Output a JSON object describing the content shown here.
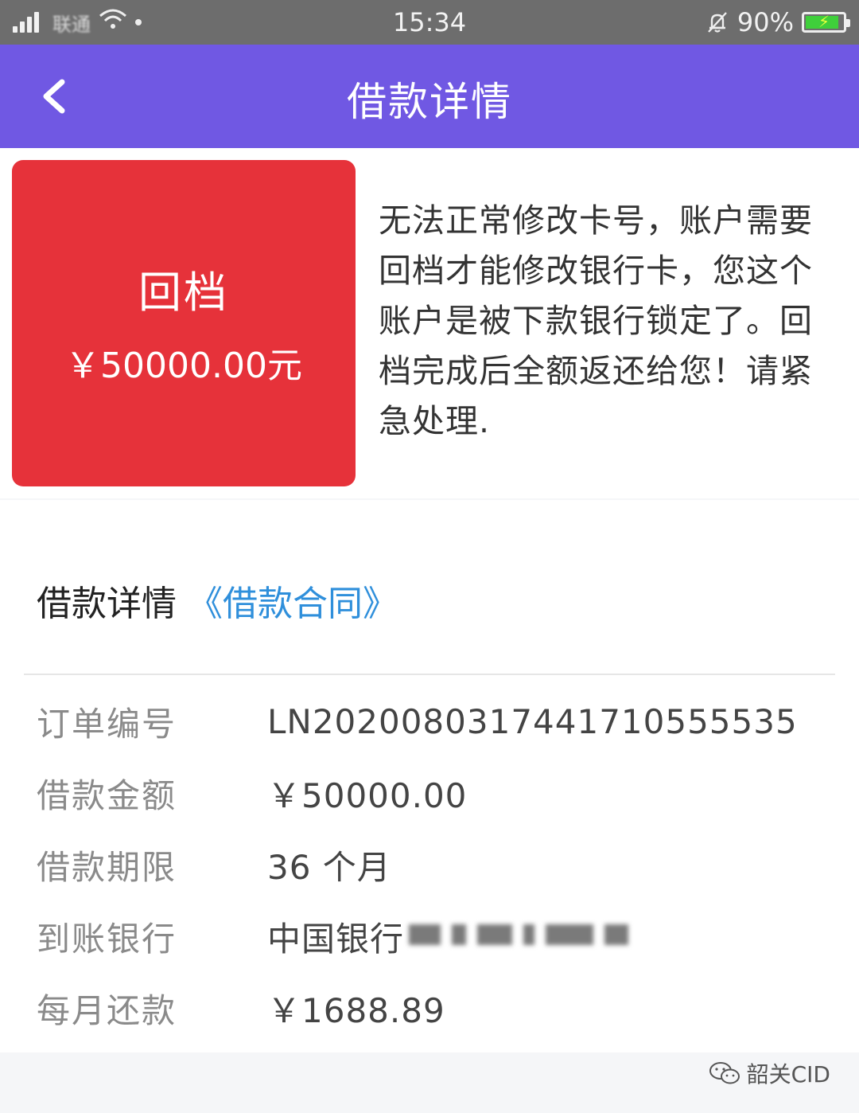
{
  "status_bar": {
    "carrier": "联通",
    "time": "15:34",
    "battery": "90%",
    "battery_level": 0.9
  },
  "nav": {
    "title": "借款详情"
  },
  "rollback_card": {
    "title": "回档",
    "amount": "￥50000.00元"
  },
  "notice": {
    "text": "无法正常修改卡号，账户需要回档才能修改银行卡，您这个账户是被下款银行锁定了。回档完成后全额返还给您！请紧急处理."
  },
  "details": {
    "header": "借款详情",
    "contract_link": "《借款合同》",
    "rows": [
      {
        "label": "订单编号",
        "value": "LN2020080317441710555535"
      },
      {
        "label": "借款金额",
        "value": "￥50000.00"
      },
      {
        "label": "借款期限",
        "value": "36 个月"
      },
      {
        "label": "到账银行",
        "value": "中国银行"
      },
      {
        "label": "每月还款",
        "value": "￥1688.89"
      }
    ]
  },
  "watermark": {
    "text": "韶关CID"
  }
}
